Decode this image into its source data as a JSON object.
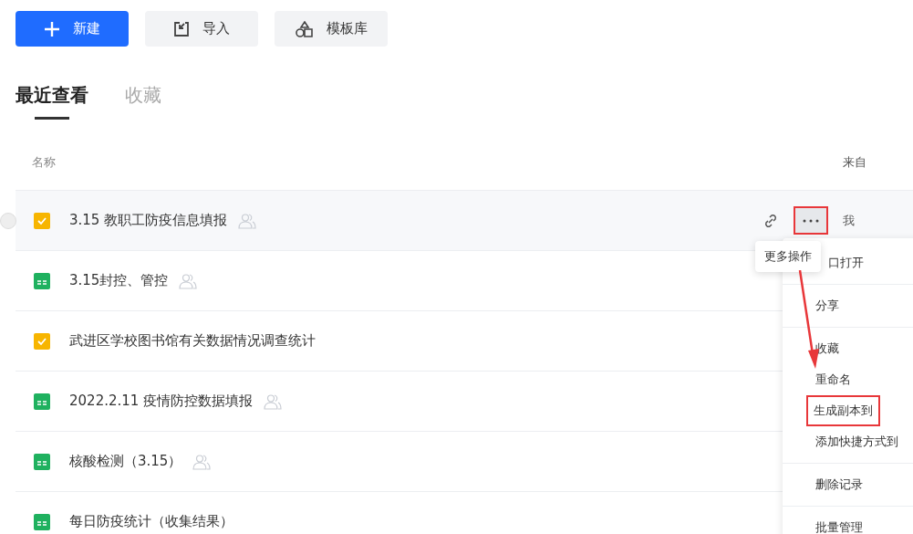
{
  "toolbar": [
    {
      "label": "新建",
      "kind": "primary"
    },
    {
      "label": "导入",
      "kind": "import"
    },
    {
      "label": "模板库",
      "kind": "template"
    }
  ],
  "tabs": [
    {
      "label": "最近查看",
      "selected": true
    },
    {
      "label": "收藏",
      "selected": false
    }
  ],
  "table": {
    "columns": [
      "名称",
      "来自"
    ],
    "rows": [
      {
        "name": "3.15 教职工防疫信息填报",
        "kind": "form",
        "shared": true,
        "hovered": true,
        "more_annotated": true,
        "from": "我"
      },
      {
        "name": "3.15封控、管控",
        "kind": "sheet",
        "shared": true,
        "hovered": false
      },
      {
        "name": "武进区学校图书馆有关数据情况调查统计",
        "kind": "form",
        "shared": false,
        "hovered": false
      },
      {
        "name": "2022.2.11 疫情防控数据填报",
        "kind": "sheet",
        "shared": true,
        "hovered": false
      },
      {
        "name": "核酸检测（3.15）",
        "kind": "sheet",
        "shared": true,
        "hovered": false
      },
      {
        "name": "每日防疫统计（收集结果）",
        "kind": "sheet",
        "shared": false,
        "hovered": false
      }
    ]
  },
  "tooltip": "更多操作",
  "menu": {
    "groups": [
      [
        {
          "label": "口打开",
          "annotated": false
        }
      ],
      [
        {
          "label": "分享",
          "annotated": false
        }
      ],
      [
        {
          "label": "收藏",
          "annotated": false
        },
        {
          "label": "重命名",
          "annotated": false
        },
        {
          "label": "生成副本到",
          "annotated": true
        },
        {
          "label": "添加快捷方式到",
          "annotated": false
        }
      ],
      [
        {
          "label": "删除记录",
          "annotated": false
        }
      ],
      [
        {
          "label": "批量管理",
          "annotated": false
        }
      ]
    ]
  },
  "annotation_arrow": true
}
